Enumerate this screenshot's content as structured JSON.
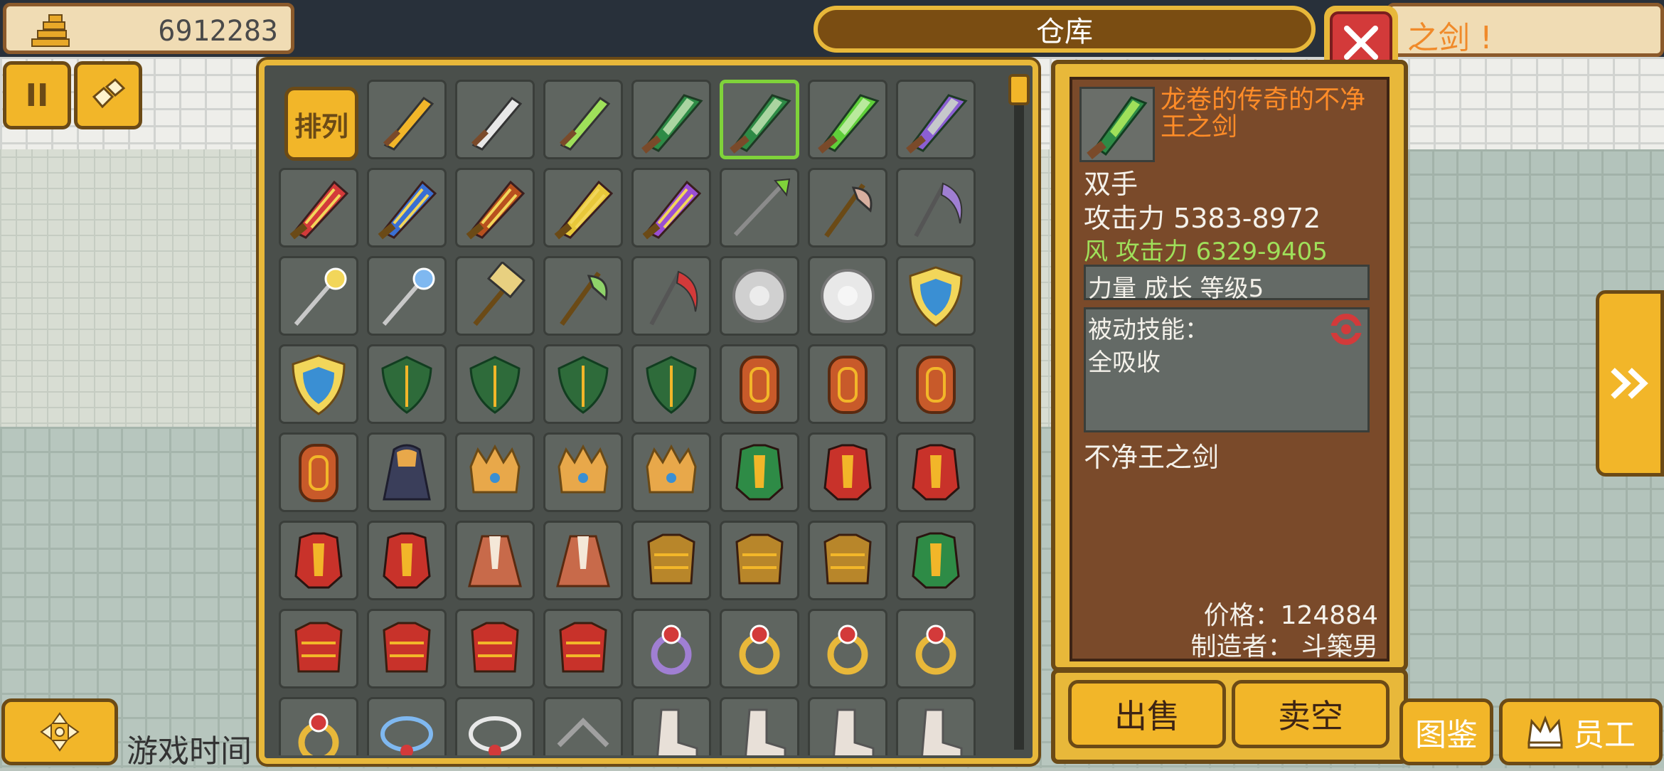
{
  "hud": {
    "money": "6912283",
    "banner_text": "之剑 !",
    "game_time_label": "游戏时间",
    "guide_button": "图鉴",
    "staff_button": "员工"
  },
  "warehouse": {
    "title": "仓库",
    "sort_button": "排列"
  },
  "colors": {
    "frame_gold": "#e8b83a",
    "dark_brown": "#6b4a16",
    "panel_brown": "#7a4a2a",
    "name_orange": "#ff8c28",
    "wind_green": "#9fe05a",
    "selected_border": "#7fd33a",
    "close_red": "#d33a3a"
  },
  "items": [
    {
      "type": "sword-icon",
      "color": "#f2b629"
    },
    {
      "type": "sword-icon",
      "color": "#e8e8e8"
    },
    {
      "type": "sword-icon",
      "color": "#9fe05a"
    },
    {
      "type": "greatsword-icon",
      "color": "#2e8b46"
    },
    {
      "type": "greatsword-icon",
      "color": "#2e8b46",
      "selected": true
    },
    {
      "type": "greatsword-icon",
      "color": "#5fcf3a"
    },
    {
      "type": "greatsword-icon",
      "color": "#8b5fd3"
    },
    {
      "type": "flame-sword-icon",
      "color": "#d33a3a"
    },
    {
      "type": "flame-sword-icon",
      "color": "#3a6fd3"
    },
    {
      "type": "flame-sword-icon",
      "color": "#b8501e"
    },
    {
      "type": "flame-sword-icon",
      "color": "#e8c83a"
    },
    {
      "type": "flame-sword-icon",
      "color": "#9a4fd3"
    },
    {
      "type": "spear-icon",
      "color": "#7fd33a"
    },
    {
      "type": "axe-icon",
      "color": "#d8b0a0"
    },
    {
      "type": "scythe-icon",
      "color": "#a07fd3"
    },
    {
      "type": "staff-icon",
      "color": "#f2d65a"
    },
    {
      "type": "staff-icon",
      "color": "#7fb8f0"
    },
    {
      "type": "hammer-icon",
      "color": "#e8d080"
    },
    {
      "type": "axe-icon",
      "color": "#8fd36a"
    },
    {
      "type": "scythe-icon",
      "color": "#d33a3a"
    },
    {
      "type": "round-shield-icon",
      "color": "#d0d0d0"
    },
    {
      "type": "round-shield-icon",
      "color": "#e8e8e8"
    },
    {
      "type": "shield-icon",
      "color": "#3a8fd3"
    },
    {
      "type": "shield-icon",
      "color": "#3a8fd3"
    },
    {
      "type": "leaf-shield-icon",
      "color": "#2e6b3a"
    },
    {
      "type": "leaf-shield-icon",
      "color": "#2e6b3a"
    },
    {
      "type": "leaf-shield-icon",
      "color": "#2e6b3a"
    },
    {
      "type": "leaf-shield-icon",
      "color": "#2e6b3a"
    },
    {
      "type": "wood-shield-icon",
      "color": "#c85a2a"
    },
    {
      "type": "wood-shield-icon",
      "color": "#c85a2a"
    },
    {
      "type": "wood-shield-icon",
      "color": "#c85a2a"
    },
    {
      "type": "wood-shield-icon",
      "color": "#c85a2a"
    },
    {
      "type": "cloak-icon",
      "color": "#3a3e5a"
    },
    {
      "type": "crown-icon",
      "color": "#e8a84a"
    },
    {
      "type": "crown-icon",
      "color": "#e8a84a"
    },
    {
      "type": "crown-icon",
      "color": "#e8a84a"
    },
    {
      "type": "armor-icon",
      "color": "#2e8b46"
    },
    {
      "type": "armor-icon",
      "color": "#c8322a"
    },
    {
      "type": "armor-icon",
      "color": "#c8322a"
    },
    {
      "type": "armor-icon",
      "color": "#c8322a"
    },
    {
      "type": "armor-icon",
      "color": "#c8322a"
    },
    {
      "type": "robe-icon",
      "color": "#c86a4a"
    },
    {
      "type": "robe-icon",
      "color": "#c86a4a"
    },
    {
      "type": "chest-armor-icon",
      "color": "#b8862a"
    },
    {
      "type": "chest-armor-icon",
      "color": "#b8862a"
    },
    {
      "type": "chest-armor-icon",
      "color": "#b8862a"
    },
    {
      "type": "armor-icon",
      "color": "#2e8b46"
    },
    {
      "type": "chest-armor-icon",
      "color": "#c8322a"
    },
    {
      "type": "chest-armor-icon",
      "color": "#c8322a"
    },
    {
      "type": "chest-armor-icon",
      "color": "#c8322a"
    },
    {
      "type": "chest-armor-icon",
      "color": "#c8322a"
    },
    {
      "type": "ring-icon",
      "color": "#a07fd3"
    },
    {
      "type": "ring-icon",
      "color": "#e8b83a"
    },
    {
      "type": "ring-icon",
      "color": "#e8b83a"
    },
    {
      "type": "ring-icon",
      "color": "#e8b83a"
    },
    {
      "type": "ring-icon",
      "color": "#e8b83a"
    },
    {
      "type": "necklace-icon",
      "color": "#7fb8f0"
    },
    {
      "type": "necklace-icon",
      "color": "#e8e8e8"
    },
    {
      "type": "bow-icon",
      "color": "#a0a0a0"
    },
    {
      "type": "boot-icon",
      "color": "#e8e0d8"
    },
    {
      "type": "boot-icon",
      "color": "#e8e0d8"
    },
    {
      "type": "boot-icon",
      "color": "#e8e0d8"
    },
    {
      "type": "boot-icon",
      "color": "#e8e0d8"
    }
  ],
  "detail": {
    "name": "龙卷的传奇的不净王之剑",
    "hand": "双手",
    "attack": "攻击力  5383-8972",
    "wind_attack": "风 攻击力 6329-9405",
    "growth": "力量 成长 等级5",
    "passive_label": "被动技能：",
    "passive_value": "全吸收",
    "base_name": "不净王之剑",
    "price": "价格：124884",
    "maker": "制造者： 斗築男"
  },
  "actions": {
    "sell": "出售",
    "sell_all": "卖空"
  }
}
